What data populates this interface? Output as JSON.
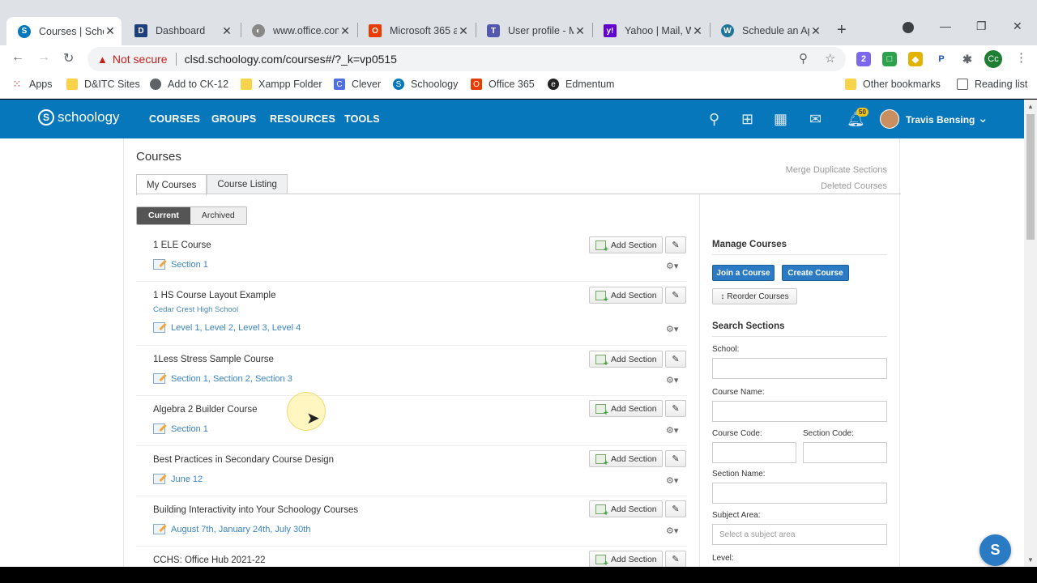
{
  "browser": {
    "tabs": [
      {
        "title": "Courses | Schoo",
        "active": true,
        "favicon_color": "#0677ba",
        "favicon": "S"
      },
      {
        "title": "Dashboard",
        "active": false,
        "favicon_color": "#c8102e",
        "favicon": "D"
      },
      {
        "title": "www.office.com",
        "active": false,
        "favicon_color": "#888888",
        "favicon": "◐"
      },
      {
        "title": "Microsoft 365 a",
        "active": false,
        "favicon_color": "#eb3c00",
        "favicon": "O"
      },
      {
        "title": "User profile - M",
        "active": false,
        "favicon_color": "#5558af",
        "favicon": "T"
      },
      {
        "title": "Yahoo | Mail, W",
        "active": false,
        "favicon_color": "#6001d2",
        "favicon": "y!"
      },
      {
        "title": "Schedule an Ap",
        "active": false,
        "favicon_color": "#21759b",
        "favicon": "W"
      }
    ],
    "new_tab_label": "+",
    "url_warning": "Not secure",
    "url": "clsd.schoology.com/courses#/?_k=vp0515",
    "profile_initials": "Cc",
    "ext_badge": "2",
    "bookmarks": [
      {
        "label": "Apps",
        "icon": "apps-grid"
      },
      {
        "label": "D&ITC Sites",
        "icon": "folder"
      },
      {
        "label": "Add to CK-12",
        "icon": "globe"
      },
      {
        "label": "Xampp Folder",
        "icon": "folder"
      },
      {
        "label": "Clever",
        "icon": "clever"
      },
      {
        "label": "Schoology",
        "icon": "schoology"
      },
      {
        "label": "Office 365",
        "icon": "office"
      },
      {
        "label": "Edmentum",
        "icon": "edmentum"
      }
    ],
    "other_bookmarks": "Other bookmarks",
    "reading_list": "Reading list"
  },
  "header": {
    "logo_text": "schoology",
    "nav": [
      "COURSES",
      "GROUPS",
      "RESOURCES",
      "TOOLS"
    ],
    "notification_count": "50",
    "user_name": "Travis Bensing"
  },
  "page": {
    "title": "Courses",
    "links": [
      "Merge Duplicate Sections",
      "Deleted Courses"
    ],
    "tabs": [
      "My Courses",
      "Course Listing"
    ],
    "filters": [
      "Current",
      "Archived"
    ],
    "add_section_label": "Add Section",
    "courses": [
      {
        "name": "1 ELE Course",
        "school": "",
        "sections": "Section 1"
      },
      {
        "name": "1 HS Course Layout Example",
        "school": "Cedar Crest High School",
        "sections": "Level 1, Level 2, Level 3, Level 4"
      },
      {
        "name": "1Less Stress Sample Course",
        "school": "",
        "sections": "Section 1, Section 2, Section 3"
      },
      {
        "name": "Algebra 2 Builder Course",
        "school": "",
        "sections": "Section 1"
      },
      {
        "name": "Best Practices in Secondary Course Design",
        "school": "",
        "sections": "June 12"
      },
      {
        "name": "Building Interactivity into Your Schoology Courses",
        "school": "",
        "sections": "August 7th, January 24th, July 30th"
      },
      {
        "name": "CCHS: Office Hub 2021-22",
        "school": "",
        "sections": ""
      }
    ]
  },
  "sidebar": {
    "manage_title": "Manage Courses",
    "join_label": "Join a Course",
    "create_label": "Create Course",
    "reorder_label": "Reorder Courses",
    "search_title": "Search Sections",
    "school_label": "School:",
    "course_name_label": "Course Name:",
    "course_code_label": "Course Code:",
    "section_code_label": "Section Code:",
    "section_name_label": "Section Name:",
    "subject_area_label": "Subject Area:",
    "subject_area_placeholder": "Select a subject area",
    "level_label": "Level:"
  },
  "help_button": "S",
  "colors": {
    "brand": "#0677ba",
    "link": "#3b84c3",
    "button_blue": "#2a7bc3"
  }
}
